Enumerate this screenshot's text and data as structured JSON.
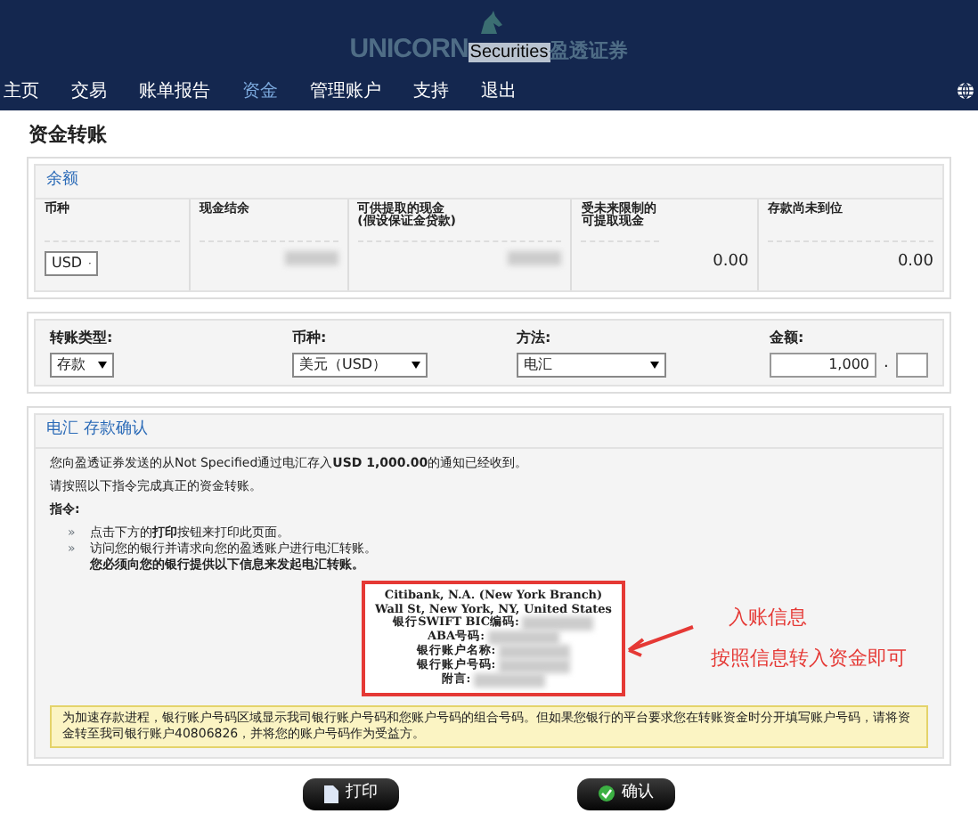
{
  "header": {
    "logo": {
      "brand": "UNICORN",
      "suffix": "Securities",
      "chinese": "盈透证券"
    }
  },
  "nav": [
    {
      "label": "主页",
      "selected": false
    },
    {
      "label": "交易",
      "selected": false
    },
    {
      "label": "账单报告",
      "selected": false
    },
    {
      "label": "资金",
      "selected": true
    },
    {
      "label": "管理账户",
      "selected": false
    },
    {
      "label": "支持",
      "selected": false
    },
    {
      "label": "退出",
      "selected": false
    }
  ],
  "page_title": "资金转账",
  "balance": {
    "title": "余额",
    "columns": [
      {
        "label": "币种",
        "kind": "select",
        "value": "USD"
      },
      {
        "label": "现金结余",
        "kind": "redacted"
      },
      {
        "label": "可供提取的现金\n(假设保证金贷款)",
        "kind": "redacted"
      },
      {
        "label": "受未来限制的可提取现金",
        "kind": "amount",
        "value": "0.00"
      },
      {
        "label": "存款尚未到位",
        "kind": "amount",
        "value": "0.00"
      }
    ]
  },
  "transfer": [
    {
      "label": "转账类型:",
      "kind": "select",
      "value": "存款"
    },
    {
      "label": "币种:",
      "kind": "select",
      "value": "美元（USD）"
    },
    {
      "label": "方法:",
      "kind": "select",
      "value": "电汇"
    },
    {
      "label": "金额:",
      "kind": "amount",
      "value": "1,000",
      "sep": "."
    }
  ],
  "confirmation": {
    "title": "电汇 存款确认",
    "paragraphs": [
      "您向盈透证券发送的从Not Specified通过电汇存入**USD 1,000.00**的通知已经收到。",
      "请按照以下指令完成真正的资金转账。"
    ],
    "instructions_title": "指令:",
    "instructions": [
      {
        "bullet": "»",
        "text": "点击下方的**打印**按钮来打印此页面。"
      },
      {
        "bullet": "»",
        "text": "访问您的银行并请求向您的盈透账户进行电汇转账。",
        "detail": "您必须向您的银行提供以下信息来发起电汇转账。"
      }
    ],
    "bank_info": [
      {
        "label": "Citibank, N.A. (New York Branch)",
        "redacted": false
      },
      {
        "label": "Wall St, New York, NY, United States",
        "redacted": false
      },
      {
        "label": "银行SWIFT BIC编码:",
        "redacted": true
      },
      {
        "label": "ABA号码:",
        "redacted": true
      },
      {
        "label": "银行账户名称:",
        "redacted": true
      },
      {
        "label": "银行账户号码:",
        "redacted": true
      },
      {
        "label": "附言:",
        "redacted": true
      }
    ],
    "annotation": {
      "title": "入账信息",
      "text": "按照信息转入资金即可"
    },
    "note": "为加速存款进程，银行账户号码区域显示我司银行账户号码和您账户号码的组合号码。但如果您银行的平台要求您在转账资金时分开填写账户号码，请将资金转至我司银行账户40806826，并将您的账户号码作为受益方。"
  },
  "buttons": [
    {
      "label": "打印",
      "kind": "print"
    },
    {
      "label": "确认",
      "kind": "confirm"
    }
  ]
}
